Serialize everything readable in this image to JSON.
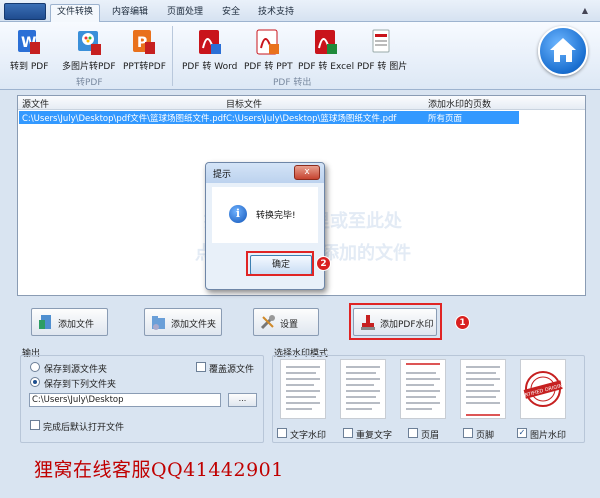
{
  "tabs": [
    {
      "label": "文件转换",
      "active": true
    },
    {
      "label": "内容编辑",
      "active": false
    },
    {
      "label": "页面处理",
      "active": false
    },
    {
      "label": "安全",
      "active": false
    },
    {
      "label": "技术支持",
      "active": false
    }
  ],
  "ribbon": {
    "to_pdf_group": "转PDF",
    "pdf_out_group": "PDF 转出",
    "buttons": [
      {
        "label": "转到 PDF",
        "icon": "word-to-pdf-icon"
      },
      {
        "label": "多图片转PDF",
        "icon": "images-to-pdf-icon"
      },
      {
        "label": "PPT转PDF",
        "icon": "ppt-to-pdf-icon"
      },
      {
        "label": "PDF 转 Word",
        "icon": "pdf-to-word-icon"
      },
      {
        "label": "PDF 转 PPT",
        "icon": "pdf-to-ppt-icon"
      },
      {
        "label": "PDF 转 Excel",
        "icon": "pdf-to-excel-icon"
      },
      {
        "label": "PDF 转 图片",
        "icon": "pdf-to-image-icon"
      }
    ]
  },
  "file_list": {
    "columns": [
      "源文件",
      "目标文件",
      "添加水印的页数"
    ],
    "rows": [
      {
        "source": "C:\\Users\\July\\Desktop\\pdf文件\\篮球场图纸文件.pdf",
        "target": "C:\\Users\\July\\Desktop\\篮球场图纸文件.pdf",
        "pages": "所有页面"
      }
    ],
    "hint_line1": "拖拽文件到这里或至此处",
    "hint_line2": "点击右键添加或添加的文件"
  },
  "dialog": {
    "title": "提示",
    "message": "转换完毕!",
    "ok_label": "确定",
    "close_label": "x"
  },
  "badges": {
    "one": "1",
    "two": "2"
  },
  "actions": {
    "add_file": "添加文件",
    "add_folder": "添加文件夹",
    "settings": "设置",
    "add_watermark": "添加PDF水印"
  },
  "output": {
    "title": "输出",
    "save_to_source": "保存到源文件夹",
    "overwrite_source": "覆盖源文件",
    "save_to_folder": "保存到下列文件夹",
    "path": "C:\\Users\\July\\Desktop",
    "browse_label": "...",
    "open_after": "完成后默认打开文件",
    "selected": "save_to_folder"
  },
  "watermark_modes": {
    "title": "选择水印模式",
    "options": [
      {
        "label": "文字水印",
        "checked": false
      },
      {
        "label": "重复文字",
        "checked": false
      },
      {
        "label": "页眉",
        "checked": false
      },
      {
        "label": "页脚",
        "checked": false
      },
      {
        "label": "图片水印",
        "checked": true
      }
    ],
    "stamp_text": "CERTIFIED ORIGINAL"
  },
  "footer_text": "狸窝在线客服QQ41442901",
  "colors": {
    "accent": "#3399ff",
    "highlight": "#e02424",
    "footer": "#c00000"
  }
}
